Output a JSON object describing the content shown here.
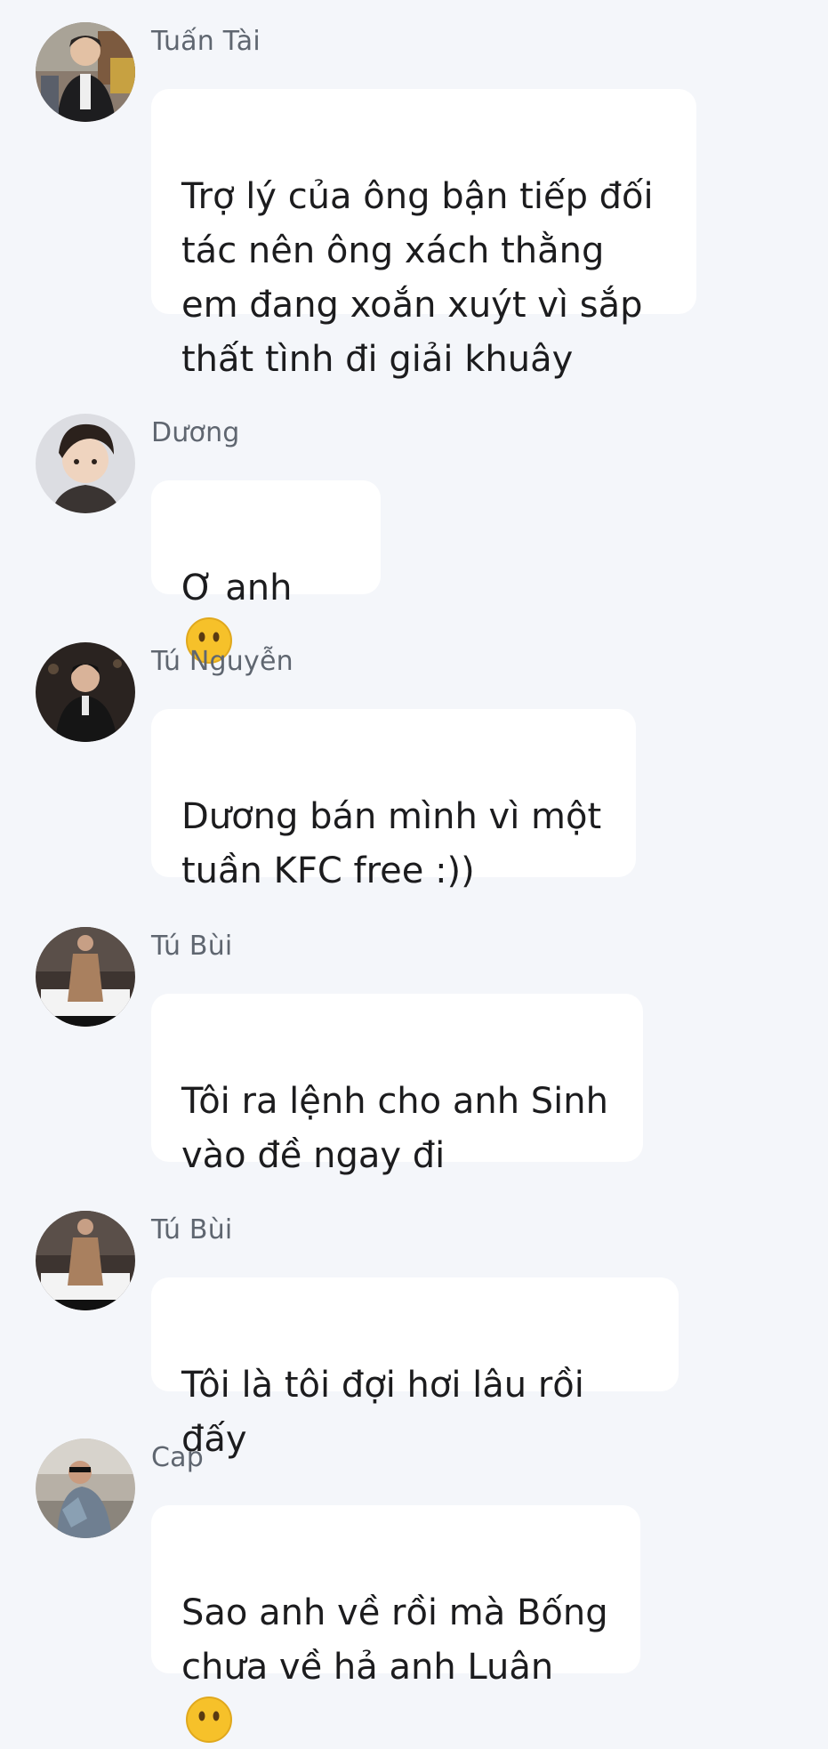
{
  "messages": [
    {
      "sender": "Tuấn Tài",
      "text": "Trợ lý của ông bận tiếp đối\ntác nên ông xách thằng\nem đang xoắn xuýt vì sắp\nthất tình đi giải khuây",
      "emoji": null
    },
    {
      "sender": "Dương",
      "text": "Ơ anh ",
      "emoji": "face-without-mouth-emoji"
    },
    {
      "sender": "Tú Nguyễn",
      "text": "Dương bán mình vì một\ntuần KFC free :))",
      "emoji": null
    },
    {
      "sender": "Tú Bùi",
      "text": "Tôi ra lệnh cho anh Sinh\nvào đề ngay đi",
      "emoji": null
    },
    {
      "sender": "Tú Bùi",
      "text": "Tôi là tôi đợi hơi lâu rồi đấy",
      "emoji": null
    },
    {
      "sender": "Cap",
      "text": "Sao anh về rồi mà Bống\nchưa về hả anh Luân ",
      "emoji": "face-without-mouth-emoji"
    }
  ],
  "colors": {
    "background": "#f4f6fa",
    "bubble": "#ffffff",
    "sender_text": "#5f6670",
    "message_text": "#1c1c1e",
    "emoji_yellow": "#f6c12a"
  }
}
